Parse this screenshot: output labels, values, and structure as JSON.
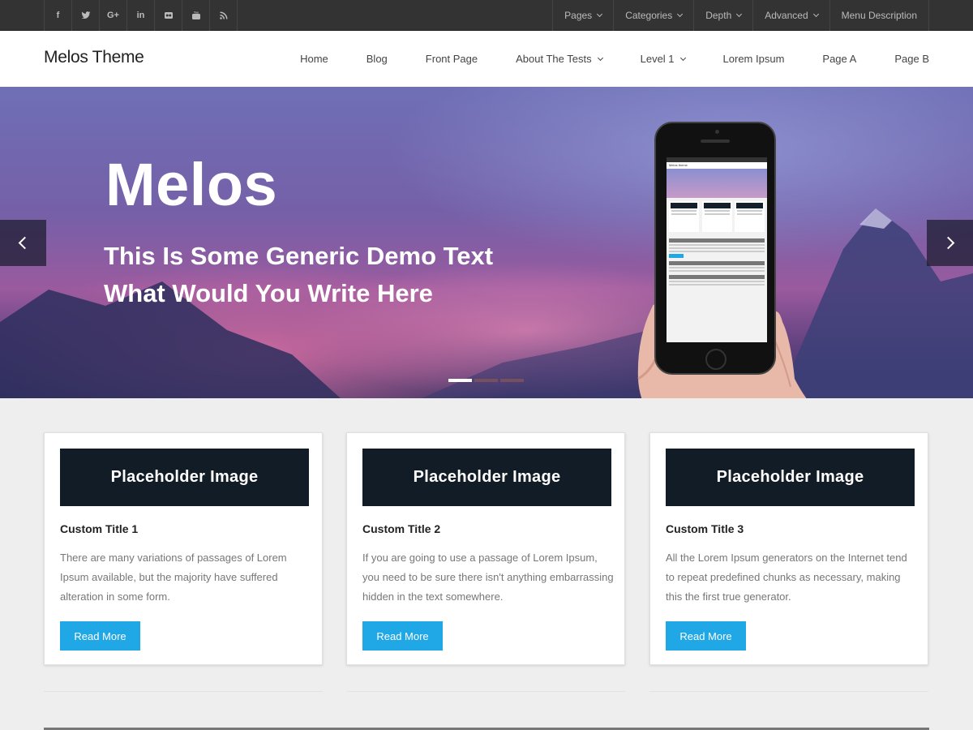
{
  "topbar": {
    "social": [
      {
        "icon": "facebook-icon",
        "glyph": "f"
      },
      {
        "icon": "twitter-icon",
        "glyph": "t"
      },
      {
        "icon": "google-plus-icon",
        "glyph": "G+"
      },
      {
        "icon": "linkedin-icon",
        "glyph": "in"
      },
      {
        "icon": "flickr-icon",
        "glyph": "●●"
      },
      {
        "icon": "youtube-icon",
        "glyph": "▶"
      },
      {
        "icon": "rss-icon",
        "glyph": "rss"
      }
    ],
    "menu": [
      {
        "label": "Pages",
        "has_dropdown": true
      },
      {
        "label": "Categories",
        "has_dropdown": true
      },
      {
        "label": "Depth",
        "has_dropdown": true
      },
      {
        "label": "Advanced",
        "has_dropdown": true
      },
      {
        "label": "Menu Description",
        "has_dropdown": false
      }
    ]
  },
  "header": {
    "brand": "Melos Theme",
    "nav": [
      {
        "label": "Home",
        "has_dropdown": false
      },
      {
        "label": "Blog",
        "has_dropdown": false
      },
      {
        "label": "Front Page",
        "has_dropdown": false
      },
      {
        "label": "About The Tests",
        "has_dropdown": true
      },
      {
        "label": "Level 1",
        "has_dropdown": true
      },
      {
        "label": "Lorem Ipsum",
        "has_dropdown": false
      },
      {
        "label": "Page A",
        "has_dropdown": false
      },
      {
        "label": "Page B",
        "has_dropdown": false
      }
    ]
  },
  "hero": {
    "title": "Melos",
    "subtitle_line1": "This Is Some Generic Demo Text",
    "subtitle_line2": "What Would You Write Here",
    "slides": 3,
    "active_slide": 1,
    "phone_brand": "Melos theme"
  },
  "cards": [
    {
      "image_label": "Placeholder Image",
      "title": "Custom Title 1",
      "text": "There are many variations of passages of Lorem Ipsum available, but the majority have suffered alteration in some form.",
      "button": "Read More"
    },
    {
      "image_label": "Placeholder Image",
      "title": "Custom Title 2",
      "text": "If you are going to use a passage of Lorem Ipsum, you need to be sure there isn't anything embarrassing hidden in the text somewhere.",
      "button": "Read More"
    },
    {
      "image_label": "Placeholder Image",
      "title": "Custom Title 3",
      "text": "All the Lorem Ipsum generators on the Internet tend to repeat predefined chunks as necessary, making this the first true generator.",
      "button": "Read More"
    }
  ],
  "colors": {
    "topbar_bg": "#333333",
    "accent": "#1fa7e6",
    "card_image_bg": "#121c26",
    "page_bg": "#eeeeee"
  }
}
